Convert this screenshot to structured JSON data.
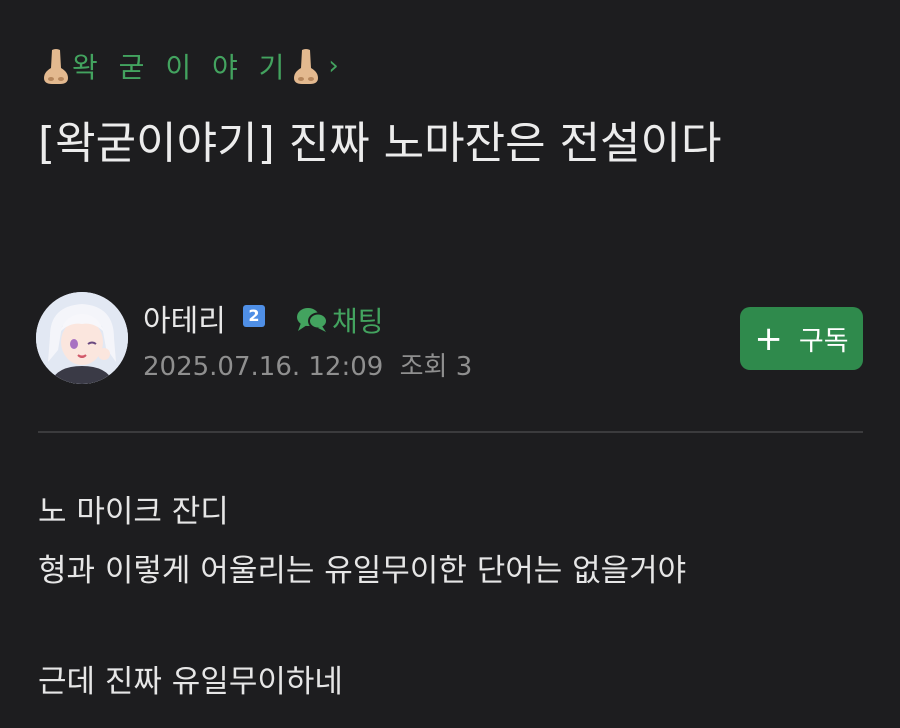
{
  "board": {
    "name": "왁 굳 이 야 기",
    "nose_emoji": "👃🏼",
    "chevron": "›"
  },
  "post": {
    "title": "[왁굳이야기] 진짜 노마잔은 전설이다"
  },
  "author": {
    "name": "아테리",
    "level": "2",
    "chat_label": "채팅",
    "date": "2025.07.16. 12:09",
    "views_label": "조회",
    "views": "3"
  },
  "subscribe": {
    "icon": "+",
    "label": "구독",
    "color": "#2f8a4c"
  },
  "accent_color": "#43a35f",
  "body": {
    "lines": [
      "노 마이크 잔디",
      "형과 이렇게 어울리는 유일무이한 단어는 없을거야",
      "근데 진짜 유일무이하네"
    ]
  }
}
